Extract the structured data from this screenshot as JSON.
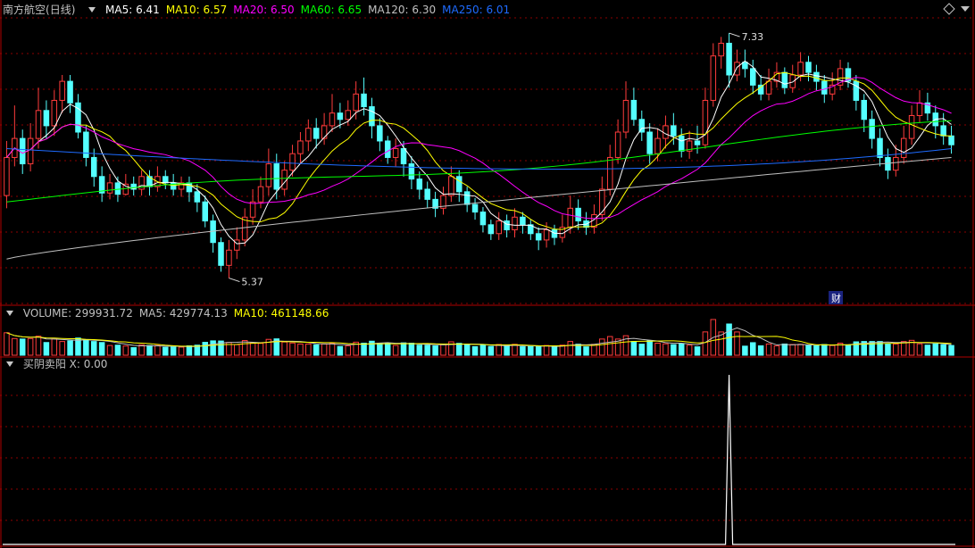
{
  "stock": {
    "name": "南方航空",
    "period": "(日线)"
  },
  "main_legend": [
    {
      "label": "MA5: 6.41",
      "color": "#ffffff"
    },
    {
      "label": "MA10: 6.57",
      "color": "#ffff00"
    },
    {
      "label": "MA20: 6.50",
      "color": "#ff00ff"
    },
    {
      "label": "MA60: 6.65",
      "color": "#00ff00"
    },
    {
      "label": "MA120: 6.30",
      "color": "#c0c0c0"
    },
    {
      "label": "MA250: 6.01",
      "color": "#1e6bff"
    }
  ],
  "volume_legend": [
    {
      "label": "VOLUME: 299931.72",
      "color": "#c0c0c0"
    },
    {
      "label": "MA5: 429774.13",
      "color": "#c0c0c0"
    },
    {
      "label": "MA10: 461148.66",
      "color": "#ffff00"
    }
  ],
  "indicator_legend": {
    "label": "买阴卖阳  X: 0.00",
    "color": "#c0c0c0"
  },
  "annotations": {
    "high": "7.33",
    "low": "5.37",
    "finance_marker": "财"
  },
  "colors": {
    "up": "#ff3c3c",
    "down": "#54ffff",
    "grid": "#8b0000",
    "frame": "#b00000"
  },
  "chart_data": {
    "type": "candlestick",
    "ylim": [
      5.2,
      7.45
    ],
    "candles": [
      [
        6.05,
        6.35,
        6.48,
        5.95
      ],
      [
        6.35,
        6.5,
        6.76,
        6.28
      ],
      [
        6.5,
        6.3,
        6.57,
        6.22
      ],
      [
        6.3,
        6.5,
        6.62,
        6.24
      ],
      [
        6.5,
        6.72,
        6.9,
        6.42
      ],
      [
        6.72,
        6.6,
        6.8,
        6.5
      ],
      [
        6.6,
        6.8,
        6.88,
        6.52
      ],
      [
        6.8,
        6.95,
        7.0,
        6.7
      ],
      [
        6.95,
        6.78,
        7.0,
        6.7
      ],
      [
        6.78,
        6.55,
        6.85,
        6.5
      ],
      [
        6.55,
        6.35,
        6.6,
        6.28
      ],
      [
        6.35,
        6.2,
        6.42,
        6.12
      ],
      [
        6.2,
        6.07,
        6.28,
        6.0
      ],
      [
        6.07,
        6.15,
        6.22,
        6.02
      ],
      [
        6.15,
        6.06,
        6.2,
        6.0
      ],
      [
        6.06,
        6.14,
        6.22,
        6.05
      ],
      [
        6.14,
        6.1,
        6.2,
        6.05
      ],
      [
        6.1,
        6.2,
        6.25,
        6.05
      ],
      [
        6.2,
        6.12,
        6.25,
        6.05
      ],
      [
        6.12,
        6.2,
        6.28,
        6.08
      ],
      [
        6.2,
        6.15,
        6.25,
        6.1
      ],
      [
        6.15,
        6.1,
        6.22,
        6.05
      ],
      [
        6.1,
        6.15,
        6.2,
        6.04
      ],
      [
        6.15,
        6.08,
        6.2,
        6.0
      ],
      [
        6.08,
        6.0,
        6.14,
        5.92
      ],
      [
        6.0,
        5.85,
        6.05,
        5.8
      ],
      [
        5.85,
        5.68,
        5.9,
        5.6
      ],
      [
        5.68,
        5.5,
        5.72,
        5.45
      ],
      [
        5.5,
        5.62,
        5.7,
        5.4
      ],
      [
        5.62,
        5.7,
        5.8,
        5.55
      ],
      [
        5.7,
        5.88,
        5.95,
        5.65
      ],
      [
        5.88,
        6.0,
        6.1,
        5.82
      ],
      [
        6.0,
        6.12,
        6.2,
        5.95
      ],
      [
        6.12,
        6.3,
        6.42,
        6.05
      ],
      [
        6.3,
        6.1,
        6.38,
        6.02
      ],
      [
        6.1,
        6.25,
        6.32,
        6.05
      ],
      [
        6.25,
        6.38,
        6.45,
        6.2
      ],
      [
        6.38,
        6.48,
        6.55,
        6.3
      ],
      [
        6.48,
        6.58,
        6.65,
        6.4
      ],
      [
        6.58,
        6.5,
        6.66,
        6.42
      ],
      [
        6.5,
        6.6,
        6.7,
        6.45
      ],
      [
        6.6,
        6.7,
        6.85,
        6.55
      ],
      [
        6.7,
        6.65,
        6.78,
        6.58
      ],
      [
        6.65,
        6.72,
        6.8,
        6.6
      ],
      [
        6.72,
        6.85,
        6.95,
        6.65
      ],
      [
        6.85,
        6.75,
        6.98,
        6.68
      ],
      [
        6.75,
        6.6,
        6.82,
        6.5
      ],
      [
        6.6,
        6.48,
        6.66,
        6.4
      ],
      [
        6.48,
        6.35,
        6.52,
        6.3
      ],
      [
        6.35,
        6.42,
        6.5,
        6.28
      ],
      [
        6.42,
        6.3,
        6.48,
        6.2
      ],
      [
        6.3,
        6.18,
        6.36,
        6.1
      ],
      [
        6.18,
        6.1,
        6.24,
        6.02
      ],
      [
        6.1,
        6.02,
        6.16,
        5.95
      ],
      [
        6.02,
        5.95,
        6.08,
        5.88
      ],
      [
        5.95,
        6.05,
        6.12,
        5.9
      ],
      [
        6.05,
        6.2,
        6.28,
        6.0
      ],
      [
        6.2,
        6.08,
        6.25,
        6.0
      ],
      [
        6.08,
        5.98,
        6.12,
        5.92
      ],
      [
        5.98,
        5.92,
        6.03,
        5.86
      ],
      [
        5.92,
        5.82,
        5.96,
        5.76
      ],
      [
        5.82,
        5.75,
        5.86,
        5.7
      ],
      [
        5.75,
        5.85,
        5.92,
        5.7
      ],
      [
        5.85,
        5.78,
        5.9,
        5.72
      ],
      [
        5.78,
        5.88,
        5.95,
        5.72
      ],
      [
        5.88,
        5.82,
        5.92,
        5.75
      ],
      [
        5.82,
        5.75,
        5.86,
        5.7
      ],
      [
        5.75,
        5.7,
        5.8,
        5.62
      ],
      [
        5.7,
        5.78,
        5.84,
        5.64
      ],
      [
        5.78,
        5.72,
        5.82,
        5.66
      ],
      [
        5.72,
        5.8,
        5.9,
        5.68
      ],
      [
        5.8,
        5.95,
        6.05,
        5.75
      ],
      [
        5.95,
        5.85,
        6.02,
        5.78
      ],
      [
        5.85,
        5.8,
        5.92,
        5.74
      ],
      [
        5.8,
        5.9,
        5.98,
        5.75
      ],
      [
        5.9,
        6.1,
        6.2,
        5.85
      ],
      [
        6.1,
        6.35,
        6.45,
        6.05
      ],
      [
        6.35,
        6.55,
        6.65,
        6.3
      ],
      [
        6.55,
        6.8,
        6.95,
        6.5
      ],
      [
        6.8,
        6.65,
        6.9,
        6.6
      ],
      [
        6.65,
        6.55,
        6.72,
        6.48
      ],
      [
        6.55,
        6.38,
        6.62,
        6.3
      ],
      [
        6.38,
        6.5,
        6.58,
        6.32
      ],
      [
        6.5,
        6.6,
        6.68,
        6.42
      ],
      [
        6.6,
        6.52,
        6.7,
        6.45
      ],
      [
        6.52,
        6.4,
        6.58,
        6.35
      ],
      [
        6.4,
        6.48,
        6.56,
        6.34
      ],
      [
        6.48,
        6.45,
        6.6,
        6.38
      ],
      [
        6.45,
        6.8,
        6.9,
        6.42
      ],
      [
        6.8,
        7.15,
        7.25,
        6.75
      ],
      [
        7.15,
        7.25,
        7.3,
        7.05
      ],
      [
        7.25,
        7.0,
        7.33,
        6.9
      ],
      [
        7.0,
        7.1,
        7.2,
        6.95
      ],
      [
        7.1,
        7.05,
        7.2,
        6.98
      ],
      [
        7.05,
        6.92,
        7.12,
        6.85
      ],
      [
        6.92,
        6.85,
        7.0,
        6.8
      ],
      [
        6.85,
        6.95,
        7.05,
        6.8
      ],
      [
        6.95,
        7.02,
        7.1,
        6.9
      ],
      [
        7.02,
        6.9,
        7.06,
        6.85
      ],
      [
        6.9,
        7.0,
        7.08,
        6.86
      ],
      [
        7.0,
        7.1,
        7.18,
        6.95
      ],
      [
        7.1,
        7.02,
        7.15,
        6.95
      ],
      [
        7.02,
        6.95,
        7.08,
        6.88
      ],
      [
        6.95,
        6.85,
        7.0,
        6.78
      ],
      [
        6.85,
        6.92,
        7.02,
        6.8
      ],
      [
        6.92,
        7.05,
        7.12,
        6.88
      ],
      [
        7.05,
        6.95,
        7.1,
        6.9
      ],
      [
        6.95,
        6.8,
        7.0,
        6.72
      ],
      [
        6.8,
        6.65,
        6.85,
        6.55
      ],
      [
        6.65,
        6.5,
        6.72,
        6.42
      ],
      [
        6.5,
        6.35,
        6.58,
        6.28
      ],
      [
        6.35,
        6.25,
        6.42,
        6.18
      ],
      [
        6.25,
        6.35,
        6.45,
        6.2
      ],
      [
        6.35,
        6.5,
        6.6,
        6.3
      ],
      [
        6.5,
        6.68,
        6.76,
        6.45
      ],
      [
        6.68,
        6.78,
        6.88,
        6.62
      ],
      [
        6.78,
        6.7,
        6.86,
        6.64
      ],
      [
        6.7,
        6.6,
        6.76,
        6.5
      ],
      [
        6.6,
        6.52,
        6.7,
        6.45
      ],
      [
        6.52,
        6.45,
        6.6,
        6.38
      ]
    ],
    "indicator_x": {
      "values": [
        0,
        1
      ],
      "ylim": [
        0,
        1
      ],
      "spike_index": 91
    }
  }
}
